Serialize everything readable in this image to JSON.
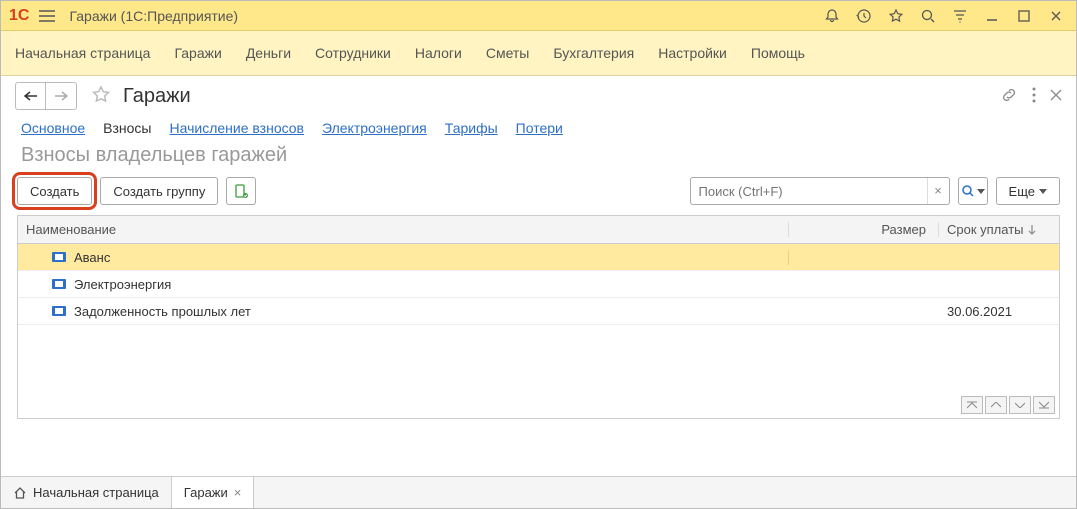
{
  "titlebar": {
    "app": "Гаражи  (1С:Предприятие)"
  },
  "menu": [
    "Начальная страница",
    "Гаражи",
    "Деньги",
    "Сотрудники",
    "Налоги",
    "Сметы",
    "Бухгалтерия",
    "Настройки",
    "Помощь"
  ],
  "page": {
    "title": "Гаражи"
  },
  "submenu": {
    "items": [
      {
        "label": "Основное",
        "und": true
      },
      {
        "label": "Взносы",
        "active": true
      },
      {
        "label": "Начисление взносов",
        "und": true
      },
      {
        "label": "Электроэнергия",
        "und": true
      },
      {
        "label": "Тарифы",
        "und": true
      },
      {
        "label": "Потери",
        "und": true
      }
    ]
  },
  "section_title": "Взносы владельцев гаражей",
  "toolbar": {
    "create": "Создать",
    "create_group": "Создать группу",
    "search_placeholder": "Поиск (Ctrl+F)",
    "more": "Еще"
  },
  "table": {
    "columns": {
      "name": "Наименование",
      "size": "Размер",
      "due": "Срок уплаты"
    },
    "rows": [
      {
        "name": "Аванс",
        "size": "",
        "due": "",
        "selected": true
      },
      {
        "name": "Электроэнергия",
        "size": "",
        "due": ""
      },
      {
        "name": "Задолженность прошлых лет",
        "size": "",
        "due": "30.06.2021"
      }
    ]
  },
  "tabs": {
    "home": "Начальная страница",
    "active": "Гаражи"
  }
}
